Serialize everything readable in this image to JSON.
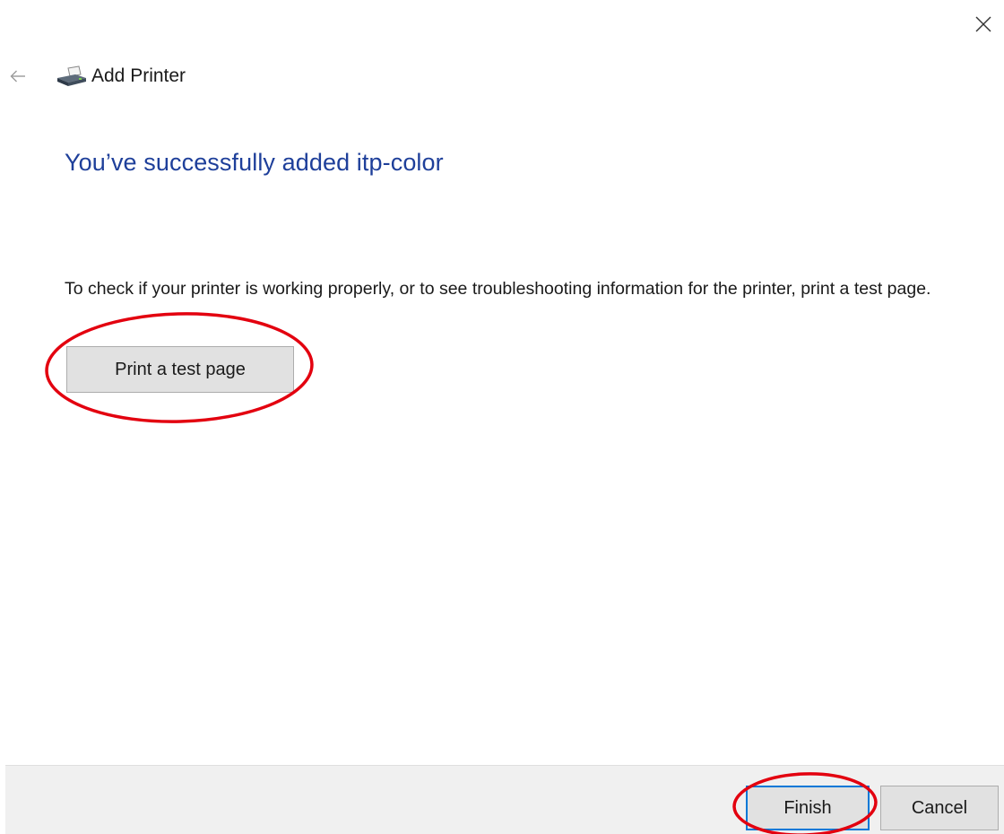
{
  "window": {
    "title": "Add Printer"
  },
  "icons": {
    "close": "close-icon",
    "back": "back-arrow-icon",
    "printer": "printer-icon"
  },
  "main": {
    "headline": "You’ve successfully added itp-color",
    "info": "To check if your printer is working properly, or to see troubleshooting information for the printer, print a test page.",
    "test_page_label": "Print a test page"
  },
  "footer": {
    "finish_label": "Finish",
    "cancel_label": "Cancel"
  },
  "colors": {
    "headline": "#1e3f9a",
    "annotation": "#e3000f",
    "button_face": "#e1e1e1",
    "footer_bg": "#f0f0f0",
    "default_button_border": "#0078d7"
  }
}
